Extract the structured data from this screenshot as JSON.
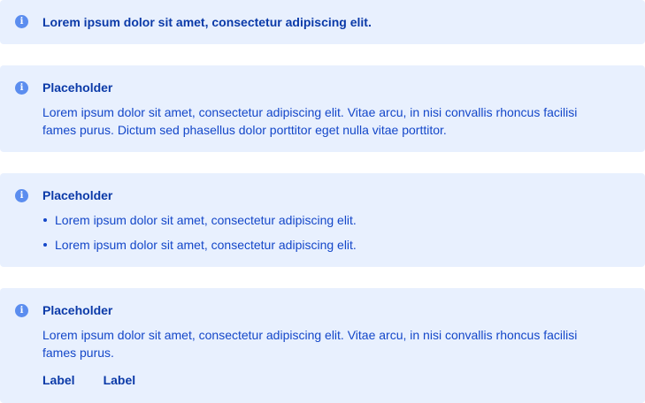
{
  "colors": {
    "alert_background": "#e8f0fe",
    "icon_fill": "#5b8def",
    "title_text": "#0b3aa8",
    "body_text": "#1447c9"
  },
  "alerts": [
    {
      "icon": "info-icon",
      "title": "Lorem ipsum dolor sit amet, consectetur adipiscing elit."
    },
    {
      "icon": "info-icon",
      "title": "Placeholder",
      "body": "Lorem ipsum dolor sit amet, consectetur adipiscing elit. Vitae arcu, in nisi convallis rhoncus facilisi fames purus. Dictum sed phasellus dolor porttitor eget nulla vitae porttitor."
    },
    {
      "icon": "info-icon",
      "title": "Placeholder",
      "items": [
        "Lorem ipsum dolor sit amet, consectetur adipiscing elit.",
        "Lorem ipsum dolor sit amet, consectetur adipiscing elit."
      ]
    },
    {
      "icon": "info-icon",
      "title": "Placeholder",
      "body": "Lorem ipsum dolor sit amet, consectetur adipiscing elit. Vitae arcu, in nisi convallis rhoncus facilisi fames purus.",
      "actions": [
        "Label",
        "Label"
      ]
    }
  ]
}
